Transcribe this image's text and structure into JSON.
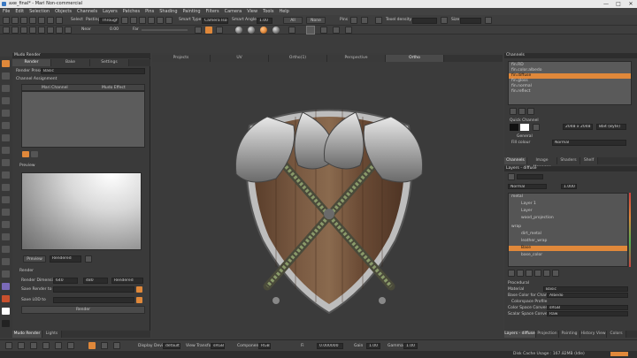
{
  "app": {
    "title": "axe_final* - Mari Non-commercial",
    "win_min": "—",
    "win_max": "□",
    "win_close": "✕"
  },
  "menu": [
    "File",
    "Edit",
    "Selection",
    "Objects",
    "Channels",
    "Layers",
    "Patches",
    "Pins",
    "Shading",
    "Painting",
    "Filters",
    "Camera",
    "View",
    "Tools",
    "Help"
  ],
  "toolbar1": {
    "select_label": "Select",
    "paint_label": "Pasting",
    "paint_value": "Through",
    "snap_label": "Smart Type",
    "snap_value": "Camera Isolated",
    "angle_label": "Smart Angle",
    "angle_value": "1.00",
    "all_btn": "All",
    "none_btn": "None",
    "pins_label": "Pins",
    "texel_label": "Texel density",
    "size_label": "Size"
  },
  "toolbar2": {
    "near_label": "Near",
    "far_label": "Far",
    "near_value": "0.00",
    "far_value": "0.50"
  },
  "left_panel": {
    "header": "Mudo Render",
    "tabs": [
      "Render",
      "Bake",
      "Settings"
    ],
    "render_preset_label": "Render Preset",
    "render_preset_value": "Basic",
    "channel_assignment": "Channel Assignment",
    "cols": [
      "Mari Channel",
      "Mudo Effect"
    ],
    "preview_label": "Preview",
    "preview_btn": "Preview",
    "preview_mode": "Rendered",
    "render_label": "Render",
    "render_dims_label": "Render Dimensions",
    "render_dims_w": "640",
    "render_dims_h": "480",
    "render_dims_mode": "Rendered",
    "save_render_label": "Save Render to",
    "save_lod_label": "Save LOD to",
    "render_btn": "Render",
    "bottom_tabs": [
      "Mudo Render",
      "Lights"
    ]
  },
  "viewport": {
    "tabs": [
      "Projects",
      "UV",
      "Ortho(1)",
      "Perspective",
      "Ortho"
    ],
    "active_tab": 4
  },
  "channels_panel": {
    "header": "Channels",
    "items": [
      "fin.RD",
      "fin.color.albedo",
      "fin.diffuse",
      "fin.gloss",
      "fin.normal",
      "fin.reflect"
    ],
    "quick_channel": "Quick Channel",
    "qc_size": "2048 x 2048",
    "qc_depth": "8bit (Byte)",
    "general": "General",
    "fx_label": "Fill colour",
    "fx_value": "Normal",
    "tabs": [
      "Channels",
      "Image Manager",
      "Shaders",
      "Shelf"
    ]
  },
  "layers_panel": {
    "header": "Layers - diffuse",
    "blend": "Normal",
    "opacity": "1.000",
    "rows": [
      "metal",
      "Layer 1",
      "Layer",
      "wood_projection",
      "wrap",
      "dirt_metal",
      "leather_wrap",
      "Base",
      "base_color"
    ],
    "procedural": "Procedural",
    "material_label": "Material",
    "material_value": "Basic",
    "base_label": "Base Color for Channel",
    "base_value": "Albedo",
    "colorspace": "Colorspace Profile",
    "cs1_label": "Color Space Conversion",
    "cs1_value": "sRGB",
    "cs2_label": "Scalar Space Conversion",
    "cs2_value": "Raw",
    "tabs": [
      "Layers - diffuse",
      "Projection",
      "Painting",
      "History View",
      "Colors"
    ]
  },
  "bottom_bar": {
    "display_device_label": "Display Device",
    "display_device_value": "default",
    "view_transform_label": "View Transform",
    "view_transform_value": "sRGB",
    "component_label": "Component",
    "component_value": "RGB",
    "exposure_label": "Fi",
    "exposure_value": "0.000000",
    "gain_label": "Gain",
    "gain_value": "1.00",
    "gamma_label": "Gamma",
    "gamma_value": "1.00"
  },
  "status": {
    "text": "Disk Cache Usage : 167.82MB (Idle)"
  },
  "colors": {
    "accent": "#e0883a",
    "bg": "#3c3c3c"
  }
}
